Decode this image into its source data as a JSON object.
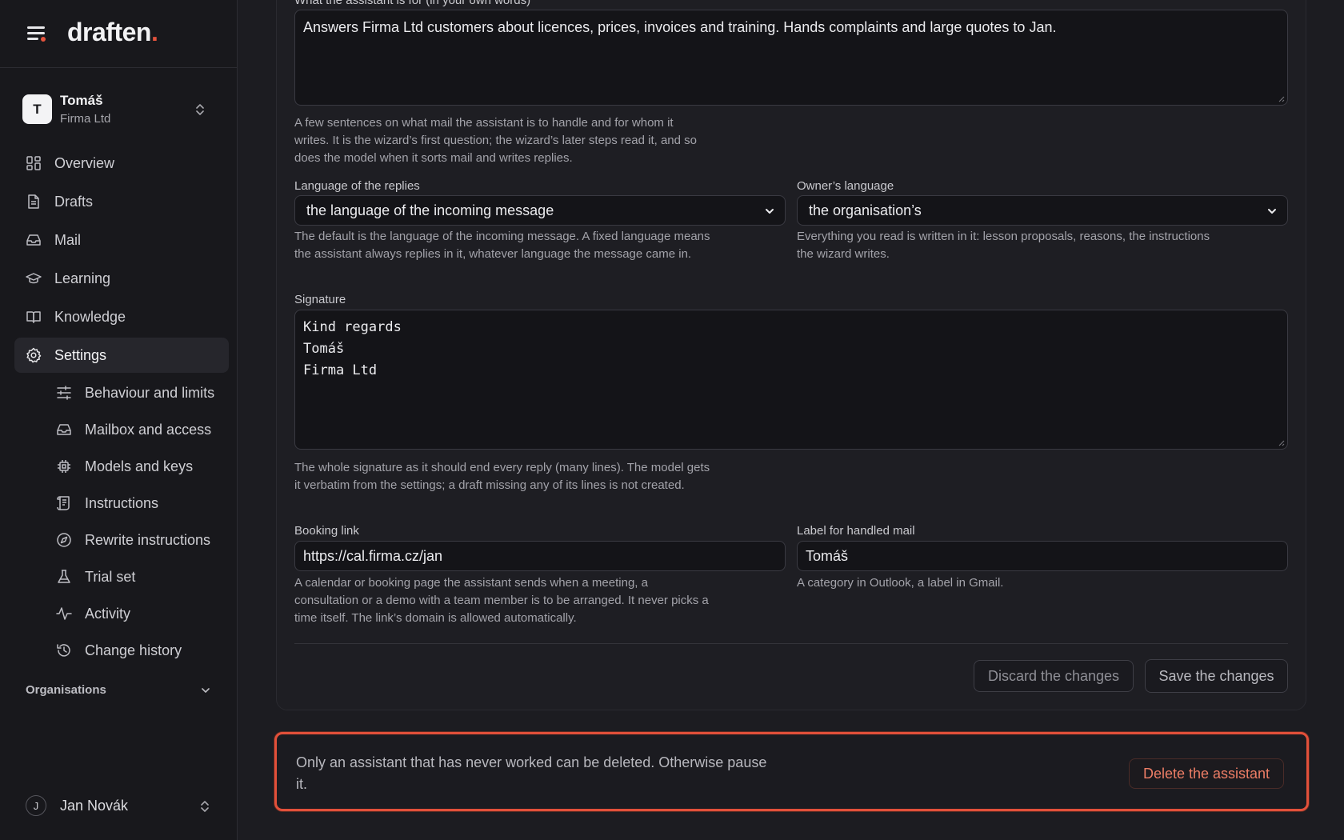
{
  "app": {
    "logo": "draften",
    "logo_dot": "."
  },
  "account": {
    "initial": "T",
    "name": "Tomáš",
    "org": "Firma Ltd"
  },
  "nav": {
    "overview": "Overview",
    "drafts": "Drafts",
    "mail": "Mail",
    "learning": "Learning",
    "knowledge": "Knowledge",
    "settings": "Settings",
    "sub": {
      "behaviour": "Behaviour and limits",
      "mailbox": "Mailbox and access",
      "models": "Models and keys",
      "instructions": "Instructions",
      "rewrite": "Rewrite instructions",
      "trial": "Trial set",
      "activity": "Activity",
      "history": "Change history"
    },
    "organisations": "Organisations"
  },
  "user": {
    "initial": "J",
    "name": "Jan Novák"
  },
  "form": {
    "purpose": {
      "label": "What the assistant is for (in your own words)",
      "value": "Answers Firma Ltd customers about licences, prices, invoices and training. Hands complaints and large quotes to Jan.",
      "help": "A few sentences on what mail the assistant is to handle and for whom it writes. It is the wizard’s first question; the wizard’s later steps read it, and so does the model when it sorts mail and writes replies."
    },
    "reply_language": {
      "label": "Language of the replies",
      "value": "the language of the incoming message",
      "help": "The default is the language of the incoming message. A fixed language means the assistant always replies in it, whatever language the message came in."
    },
    "owner_language": {
      "label": "Owner’s language",
      "value": "the organisation’s",
      "help": "Everything you read is written in it: lesson proposals, reasons, the instructions the wizard writes."
    },
    "signature": {
      "label": "Signature",
      "lines": [
        "Kind regards",
        "Tomáš",
        "Firma Ltd"
      ],
      "help": "The whole signature as it should end every reply (many lines). The model gets it verbatim from the settings; a draft missing any of its lines is not created."
    },
    "booking": {
      "label": "Booking link",
      "value": "https://cal.firma.cz/jan",
      "help": "A calendar or booking page the assistant sends when a meeting, a consultation or a demo with a team member is to be arranged. It never picks a time itself. The link’s domain is allowed automatically."
    },
    "handled_label": {
      "label": "Label for handled mail",
      "value": "Tomáš",
      "help": "A category in Outlook, a label in Gmail."
    },
    "discard_label": "Discard the changes",
    "save_label": "Save the changes"
  },
  "danger": {
    "text": "Only an assistant that has never worked can be deleted. Otherwise pause it.",
    "delete_label": "Delete the assistant"
  },
  "colors": {
    "accent_red": "#e2503a",
    "background": "#1c1c21",
    "sidebar": "#18181c"
  }
}
